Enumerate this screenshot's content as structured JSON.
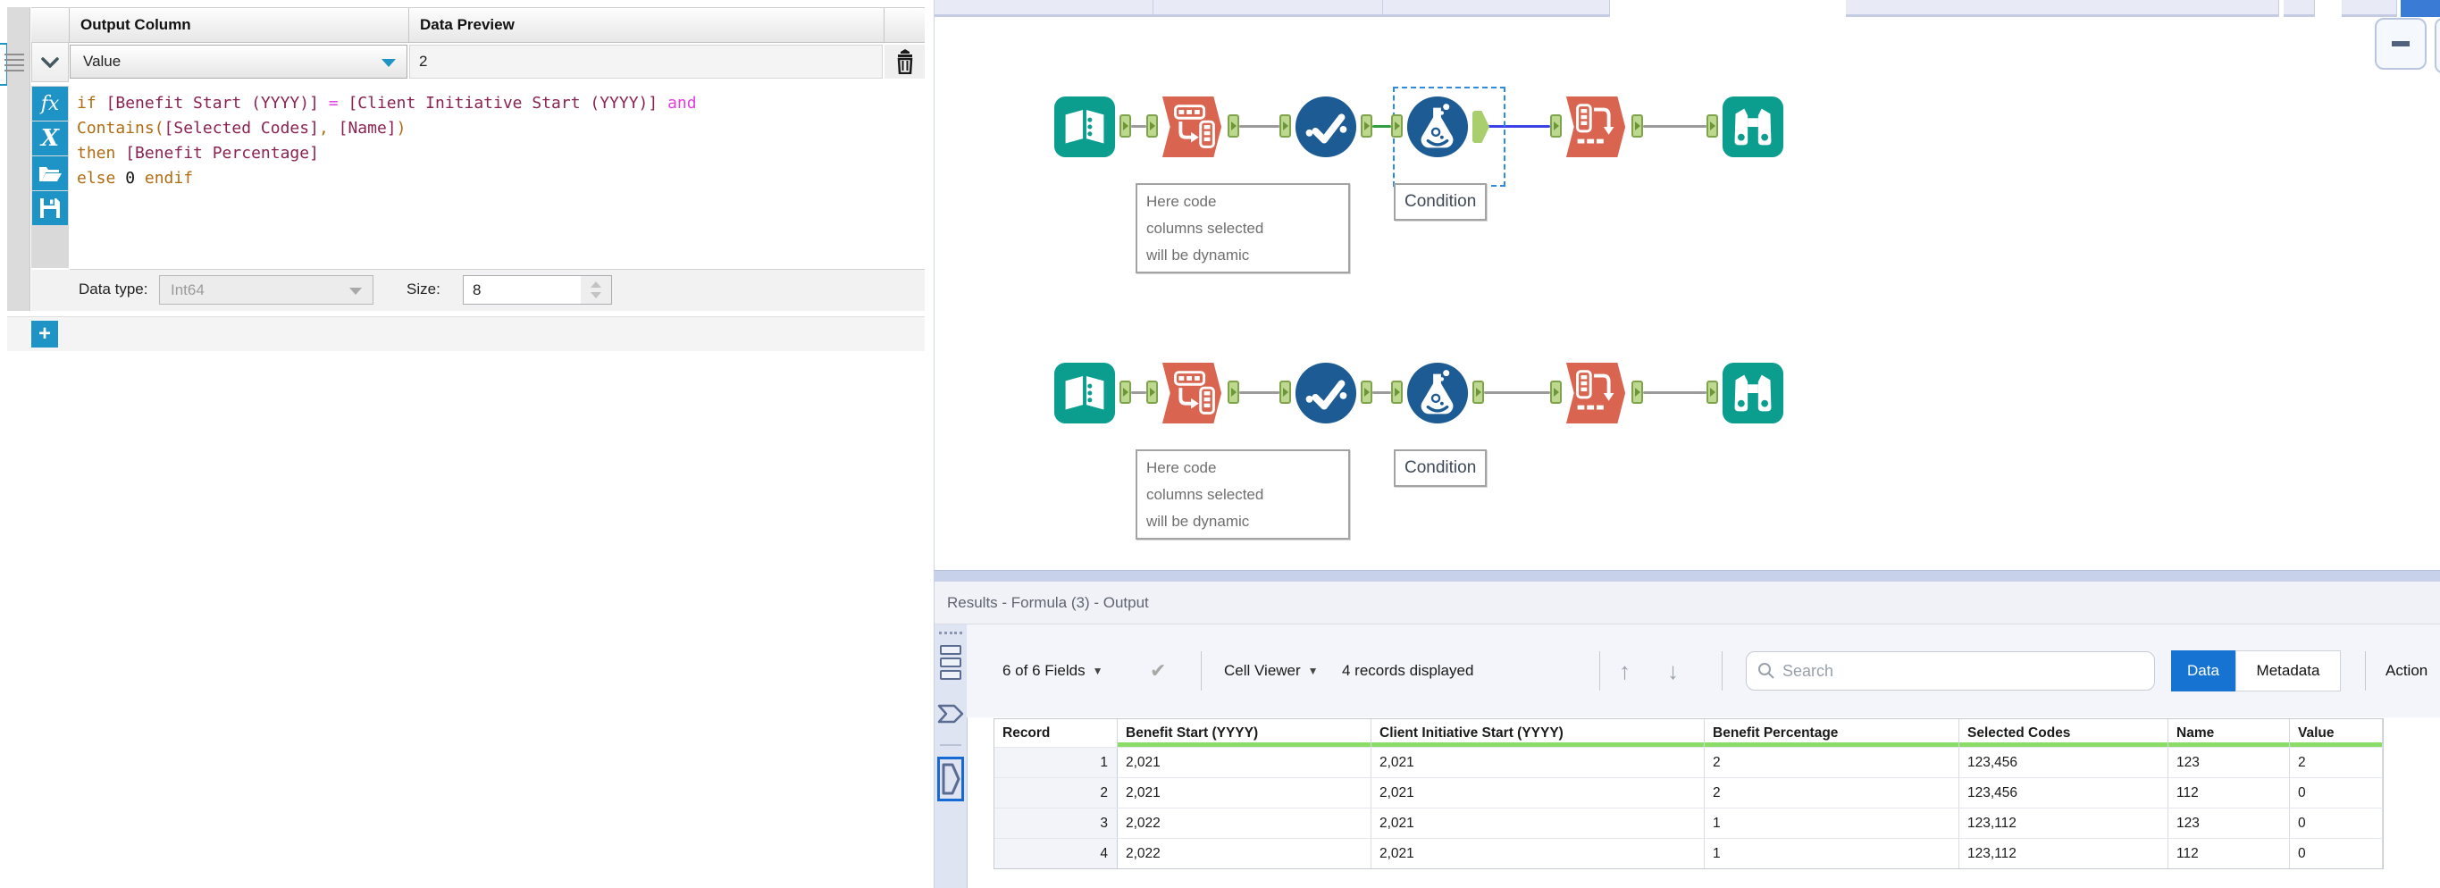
{
  "formula_panel": {
    "columns": {
      "output": "Output Column",
      "preview": "Data Preview"
    },
    "expression_row": {
      "output_column": "Value",
      "data_preview": "2"
    },
    "editor_lines": [
      [
        {
          "t": "kw",
          "x": "if "
        },
        {
          "t": "field",
          "x": "[Benefit Start (YYYY)]"
        },
        {
          "t": "op",
          "x": " = "
        },
        {
          "t": "field",
          "x": "[Client Initiative Start (YYYY)]"
        },
        {
          "t": "op",
          "x": " and"
        }
      ],
      [
        {
          "t": "fn",
          "x": "Contains("
        },
        {
          "t": "field",
          "x": "[Selected Codes]"
        },
        {
          "t": "fn",
          "x": ", "
        },
        {
          "t": "field",
          "x": "[Name]"
        },
        {
          "t": "fn",
          "x": ")"
        }
      ],
      [
        {
          "t": "kw",
          "x": "then "
        },
        {
          "t": "field",
          "x": "[Benefit Percentage]"
        }
      ],
      [
        {
          "t": "kw",
          "x": "else "
        },
        {
          "t": "num",
          "x": "0"
        },
        {
          "t": "kw",
          "x": " endif"
        }
      ]
    ],
    "footer": {
      "data_type_label": "Data type:",
      "data_type_value": "Int64",
      "size_label": "Size:",
      "size_value": "8"
    },
    "add_button": "+"
  },
  "canvas": {
    "rows": [
      {
        "tools": [
          "input-data",
          "transpose",
          "select",
          "formula",
          "cross-tab",
          "browse"
        ],
        "wires": [
          "gray",
          "gray",
          "green",
          "blue",
          "gray"
        ],
        "selected_tool_index": 3,
        "condition_label": "Condition",
        "annotation_lines": [
          "Here code",
          "columns selected",
          "will be dynamic"
        ]
      },
      {
        "tools": [
          "input-data",
          "transpose",
          "select",
          "formula",
          "cross-tab",
          "browse"
        ],
        "wires": [
          "gray",
          "gray",
          "gray",
          "gray",
          "gray"
        ],
        "selected_tool_index": -1,
        "condition_label": "Condition",
        "annotation_lines": [
          "Here code",
          "columns selected",
          "will be dynamic"
        ]
      }
    ]
  },
  "results": {
    "title": "Results - Formula (3) - Output",
    "toolbar": {
      "fields_summary": "6 of 6 Fields",
      "cell_viewer": "Cell Viewer",
      "records_displayed": "4 records displayed",
      "search_placeholder": "Search",
      "data_tab": "Data",
      "metadata_tab": "Metadata",
      "actions_label": "Action"
    },
    "table": {
      "columns": [
        "Record",
        "Benefit Start (YYYY)",
        "Client Initiative Start (YYYY)",
        "Benefit Percentage",
        "Selected Codes",
        "Name",
        "Value"
      ],
      "rows": [
        [
          "1",
          "2,021",
          "2,021",
          "2",
          "123,456",
          "123",
          "2"
        ],
        [
          "2",
          "2,021",
          "2,021",
          "2",
          "123,456",
          "112",
          "0"
        ],
        [
          "3",
          "2,022",
          "2,021",
          "1",
          "123,112",
          "123",
          "0"
        ],
        [
          "4",
          "2,022",
          "2,021",
          "1",
          "123,112",
          "112",
          "0"
        ]
      ]
    }
  },
  "colors": {
    "accent_blue": "#1d93c6",
    "tool_teal": "#0b9e8f",
    "tool_orange": "#d96450",
    "tool_blue": "#1d5b94",
    "wire_gray": "#9b9b9b",
    "wire_green": "#2e9e3f",
    "wire_blue": "#3a42e8",
    "selection_blue": "#2e8ae6",
    "results_active_blue": "#1673d2",
    "quality_green": "#8ade67",
    "syntax": {
      "keyword": "#b06c12",
      "function": "#b06c12",
      "field": "#8b2252",
      "operator": "#e23ee2",
      "number": "#111111"
    }
  }
}
